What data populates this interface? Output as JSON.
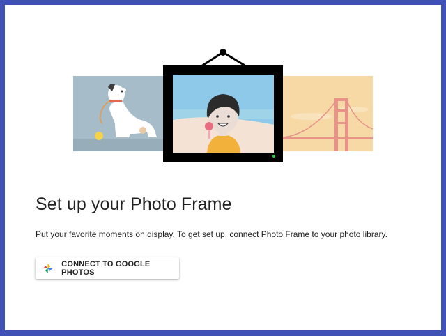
{
  "page": {
    "title": "Set up your Photo Frame",
    "subtitle": "Put your favorite moments on display. To get set up, connect Photo Frame to your photo library."
  },
  "connect_button": {
    "label": "CONNECT TO GOOGLE PHOTOS",
    "icon": "google-photos-icon"
  },
  "colors": {
    "background": "#3f51b5",
    "card": "#ffffff",
    "frame": "#000000",
    "status_led": "#2ecc40"
  }
}
